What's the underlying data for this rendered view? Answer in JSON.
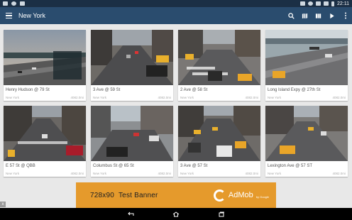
{
  "status_bar": {
    "time": "22:11",
    "icons": [
      "screenshot-icon",
      "android-icon",
      "photo-icon",
      "bluetooth-icon",
      "alarm-icon",
      "wifi-icon",
      "signal-icon",
      "battery-icon"
    ]
  },
  "app_bar": {
    "title": "New York",
    "actions": [
      "search-icon",
      "map-icon",
      "grid-icon",
      "play-icon",
      "more-icon"
    ]
  },
  "cameras": [
    {
      "caption": "Henry Hudson @ 79 St",
      "city": "New York",
      "size": "4082.0mi"
    },
    {
      "caption": "3 Ave @ 59 St",
      "city": "New York",
      "size": "4082.0mi"
    },
    {
      "caption": "2 Ave @ 58 St",
      "city": "New York",
      "size": "4082.0mi"
    },
    {
      "caption": "Long Island Expy @ 27th St",
      "city": "New York",
      "size": "4082.0mi"
    },
    {
      "caption": "E 57 St @ QBB",
      "city": "New York",
      "size": "4082.0mi"
    },
    {
      "caption": "Columbus St @ 65 St",
      "city": "New York",
      "size": "4082.0mi"
    },
    {
      "caption": "3 Ave @ 57 St",
      "city": "New York",
      "size": "4082.0mi"
    },
    {
      "caption": "Lexington Ave @ 57 ST",
      "city": "New York",
      "size": "4082.0mi"
    }
  ],
  "ad": {
    "size_text": "728x90",
    "label": "Test Banner",
    "brand": "AdMob",
    "by": "by Google",
    "close": "x"
  },
  "nav_bar": [
    "back-icon",
    "home-icon",
    "recents-icon"
  ]
}
